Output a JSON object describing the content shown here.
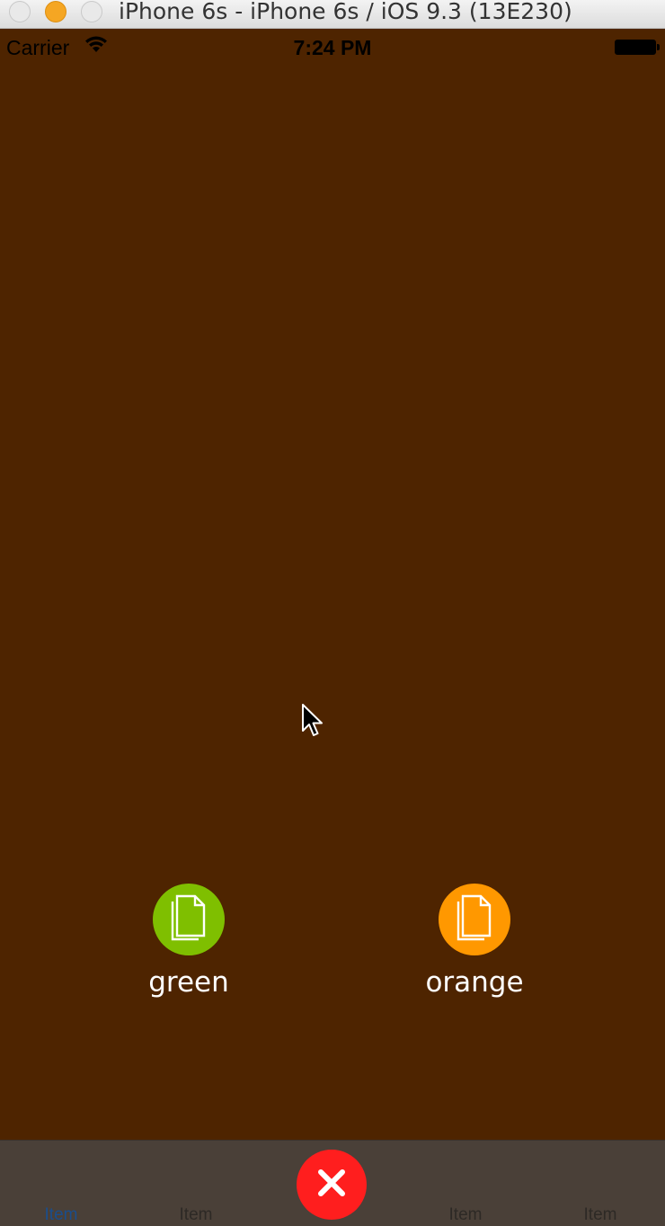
{
  "window": {
    "title": "iPhone 6s - iPhone 6s / iOS 9.3 (13E230)"
  },
  "status_bar": {
    "carrier": "Carrier",
    "time": "7:24 PM",
    "wifi_icon": "wifi-icon",
    "battery_icon": "battery-icon"
  },
  "colors": {
    "background": "#4e2400",
    "green": "#7fbf00",
    "orange": "#ff9800",
    "close": "#ff1e1e",
    "tab_active": "#1a4d8c"
  },
  "actions": [
    {
      "label": "green",
      "icon": "document-icon"
    },
    {
      "label": "orange",
      "icon": "document-icon"
    }
  ],
  "tab_bar": {
    "items": [
      {
        "label": "Item",
        "active": true
      },
      {
        "label": "Item",
        "active": false
      },
      {
        "label": "Item",
        "active": false
      },
      {
        "label": "Item",
        "active": false
      }
    ],
    "center_button_icon": "close-icon"
  }
}
